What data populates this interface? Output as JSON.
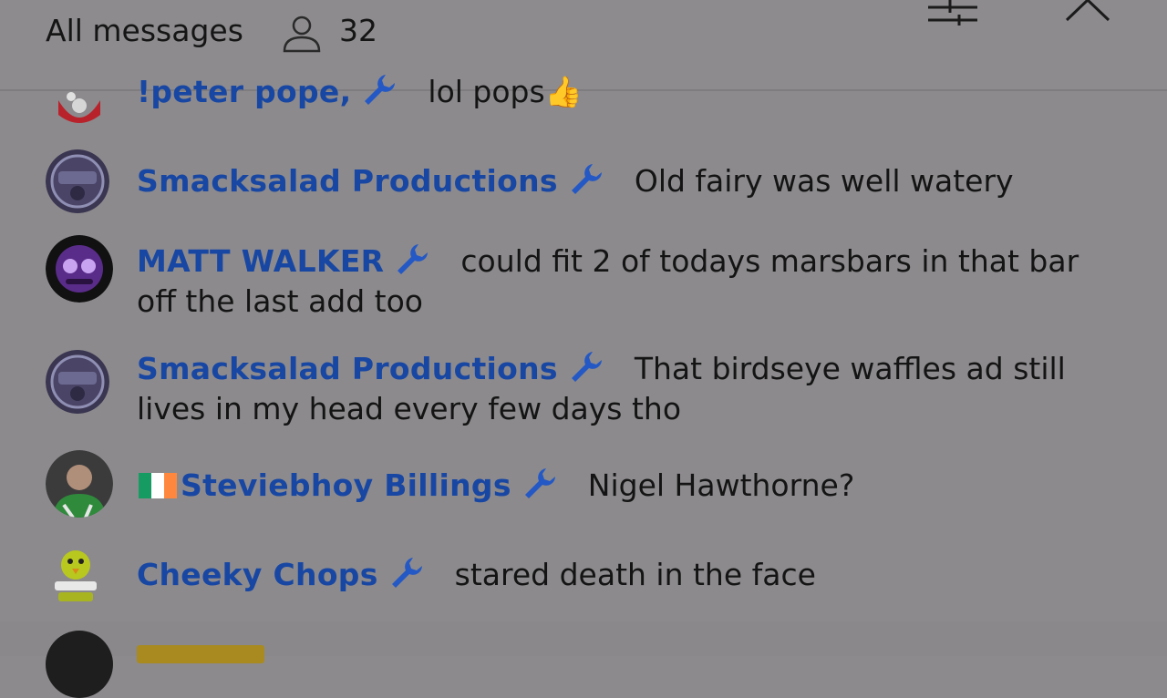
{
  "header": {
    "title": "All messages",
    "viewer_count": "32",
    "icons": [
      "person-icon",
      "filter-sliders-icon",
      "chevron-up-icon"
    ]
  },
  "colors": {
    "overlay_bg": "#8c8a8d",
    "author": "#1847a3",
    "text": "#141414",
    "wrench": "#2458c4"
  },
  "messages": [
    {
      "author": "!peter pope,",
      "text": "lol pops",
      "suffix": "👍",
      "moderator": true,
      "avatar_icon": "clown-avatar"
    },
    {
      "author": "Smacksalad Productions",
      "text": "Old fairy was well watery",
      "moderator": true,
      "avatar_icon": "badge-avatar"
    },
    {
      "author": "MATT WALKER",
      "text": "could fit 2 of todays marsbars in that bar off the last add too",
      "moderator": true,
      "avatar_icon": "purple-mask-avatar"
    },
    {
      "author": "Smacksalad Productions",
      "text": "That birdseye waffles ad still lives in my head every few days tho",
      "moderator": true,
      "avatar_icon": "badge-avatar"
    },
    {
      "author": "Steviebhoy Billings",
      "text": "Nigel Hawthorne?",
      "moderator": true,
      "flag": "ireland-flag",
      "avatar_icon": "photo-avatar"
    },
    {
      "author": "Cheeky Chops",
      "text": "stared death in the face",
      "moderator": true,
      "avatar_icon": "chick-avatar"
    }
  ]
}
